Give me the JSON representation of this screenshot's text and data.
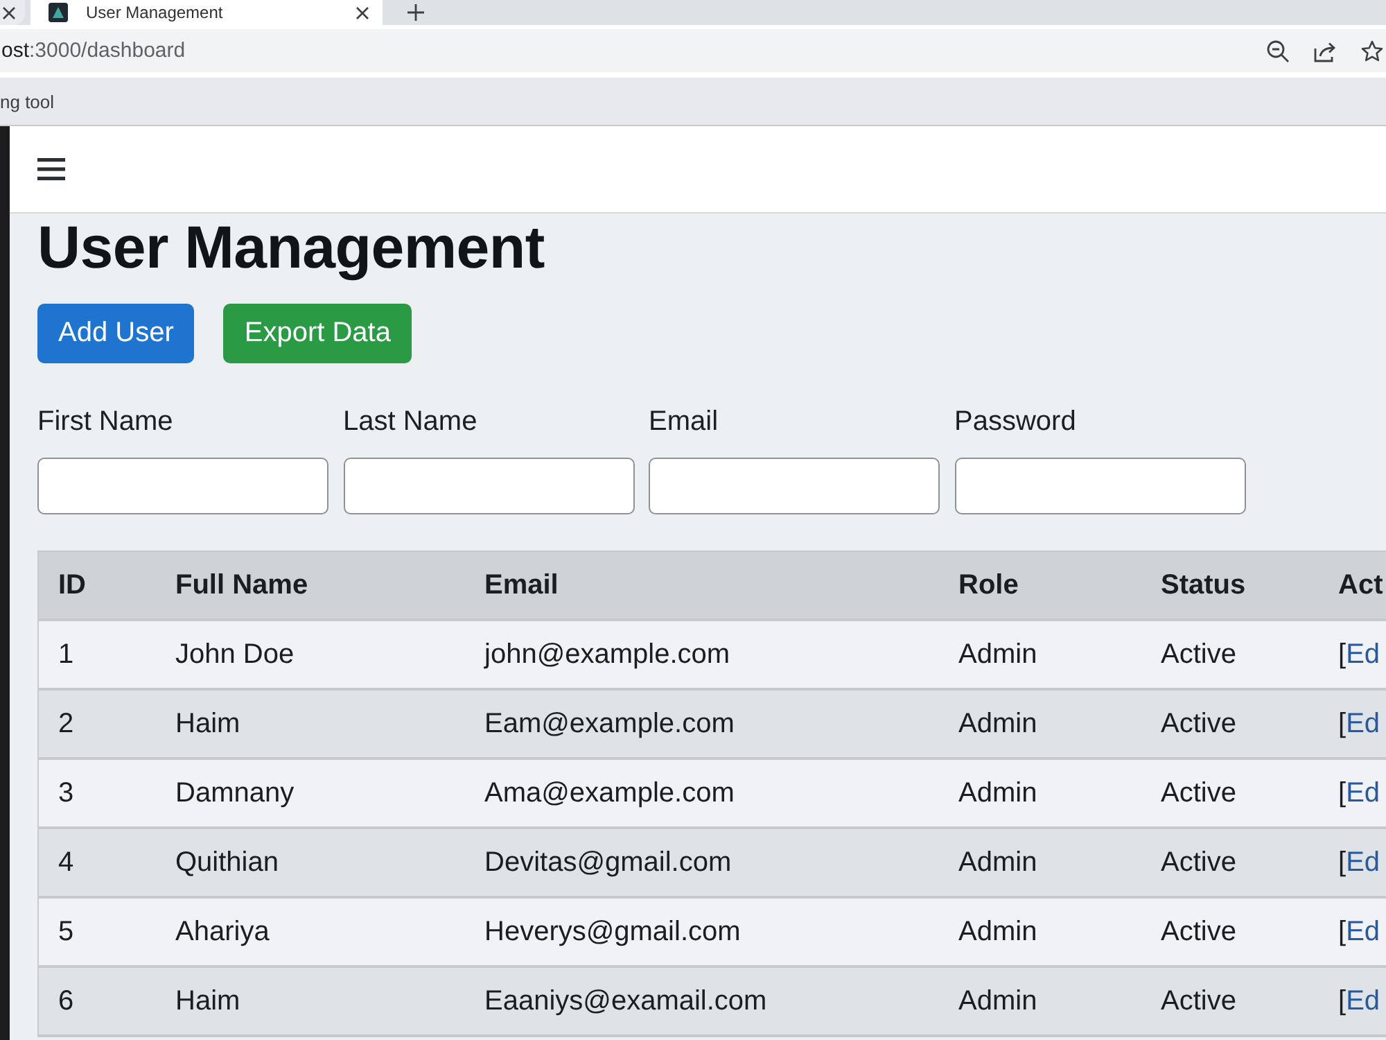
{
  "browser": {
    "tabs": [
      {
        "selected": false
      },
      {
        "selected": true,
        "title": "User Management"
      }
    ],
    "address_bar": {
      "host": "ost",
      "path": ":3000/dashboard"
    },
    "bookmarks": [
      {
        "label": "ng tool"
      }
    ]
  },
  "page": {
    "title": "User Management",
    "buttons": [
      {
        "label": "Add User",
        "kind": "primary"
      },
      {
        "label": "Export Data",
        "kind": "success"
      }
    ],
    "form_fields": [
      {
        "label": "First Name"
      },
      {
        "label": "Last Name"
      },
      {
        "label": "Email"
      },
      {
        "label": "Password"
      }
    ],
    "table": {
      "columns": [
        "ID",
        "Full Name",
        "Email",
        "Role",
        "Status",
        "Act"
      ],
      "rows": [
        {
          "id": "1",
          "full_name": "John Doe",
          "email": "john@example.com",
          "role": "Admin",
          "status": "Active",
          "action": {
            "bracket": "[",
            "link": "Ed"
          }
        },
        {
          "id": "2",
          "full_name": "Haim",
          "email": "Eam@example.com",
          "role": "Admin",
          "status": "Active",
          "action": {
            "bracket": "[",
            "link": "Ed"
          }
        },
        {
          "id": "3",
          "full_name": "Damnany",
          "email": "Ama@example.com",
          "role": "Admin",
          "status": "Active",
          "action": {
            "bracket": "[",
            "link": "Ed"
          }
        },
        {
          "id": "4",
          "full_name": "Quithian",
          "email": "Devitas@gmail.com",
          "role": "Admin",
          "status": "Active",
          "action": {
            "bracket": "[",
            "link": "Ed"
          }
        },
        {
          "id": "5",
          "full_name": "Ahariya",
          "email": "Heverys@gmail.com",
          "role": "Admin",
          "status": "Active",
          "action": {
            "bracket": "[",
            "link": "Ed"
          }
        },
        {
          "id": "6",
          "full_name": "Haim",
          "email": "Eaaniys@examail.com",
          "role": "Admin",
          "status": "Active",
          "action": {
            "bracket": "[",
            "link": "Ed"
          }
        }
      ]
    }
  }
}
